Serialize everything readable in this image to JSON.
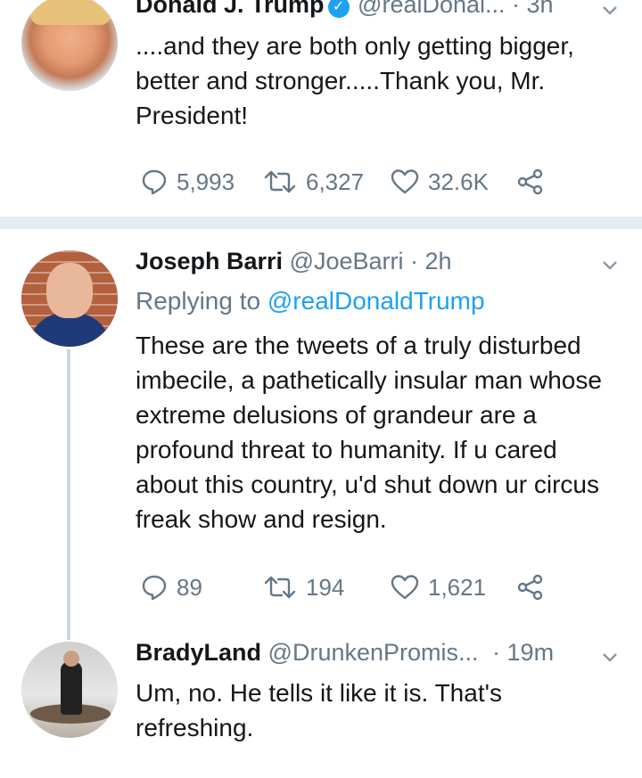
{
  "tweets": [
    {
      "name": "Donald J. Trump",
      "verified": true,
      "handle": "@realDonal...",
      "time": "· 3h",
      "text": "....and they are both only getting bigger, better and stronger.....Thank you, Mr. President!",
      "replies": "5,993",
      "retweets": "6,327",
      "likes": "32.6K"
    },
    {
      "name": "Joseph Barri",
      "handle": "@JoeBarri",
      "time": "· 2h",
      "replying_prefix": "Replying to",
      "replying_handle": "@realDonaldTrump",
      "text": "These are the tweets of a truly disturbed imbecile, a pathetically insular man whose extreme delusions of grandeur are a profound threat to humanity. If u cared about this country, u'd shut down ur circus freak show and resign.",
      "replies": "89",
      "retweets": "194",
      "likes": "1,621"
    },
    {
      "name": "BradyLand",
      "handle": "@DrunkenPromis...",
      "time": "· 19m",
      "text": "Um, no. He tells it like it is. That's refreshing."
    }
  ],
  "colors": {
    "accent": "#1da1f2",
    "muted": "#657786",
    "text": "#14171a",
    "divider": "#e6ecf0",
    "thread": "#ccd6dd"
  },
  "icons": [
    "verified-badge-icon",
    "chevron-down-icon",
    "reply-icon",
    "retweet-icon",
    "like-icon",
    "share-icon"
  ]
}
